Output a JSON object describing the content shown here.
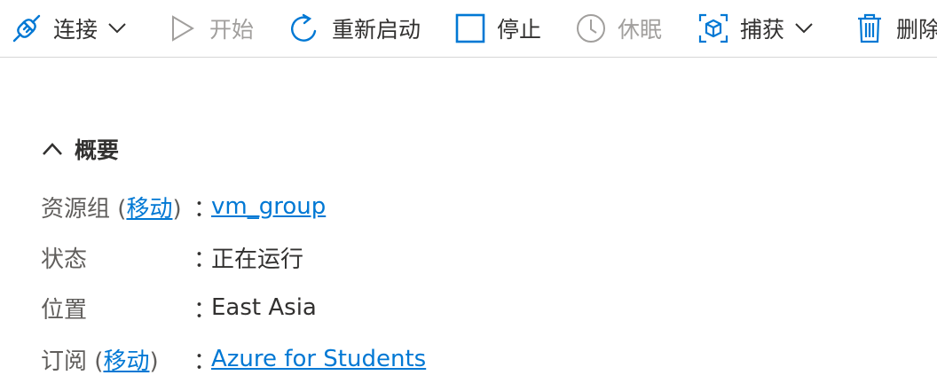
{
  "toolbar": {
    "connect": "连接",
    "start": "开始",
    "restart": "重新启动",
    "stop": "停止",
    "hibernate": "休眠",
    "capture": "捕获",
    "delete": "删除"
  },
  "overview": {
    "title": "概要",
    "resource_group": {
      "label": "资源组",
      "paren_open": "(",
      "move": "移动",
      "paren_close": ")",
      "value": "vm_group"
    },
    "status": {
      "label": "状态",
      "value": "正在运行"
    },
    "location": {
      "label": "位置",
      "value": "East Asia"
    },
    "subscription": {
      "label": "订阅",
      "paren_open": "(",
      "move": "移动",
      "paren_close": ")",
      "value": "Azure for Students"
    },
    "colon": "："
  },
  "colors": {
    "accent": "#0078d4",
    "text": "#323130",
    "muted": "#605e5c",
    "disabled": "#a19f9d"
  },
  "icons": [
    "connect-icon",
    "play-icon",
    "restart-icon",
    "stop-icon",
    "hibernate-clock-icon",
    "capture-cube-icon",
    "trash-icon",
    "chevron-down-icon",
    "chevron-up-icon"
  ]
}
